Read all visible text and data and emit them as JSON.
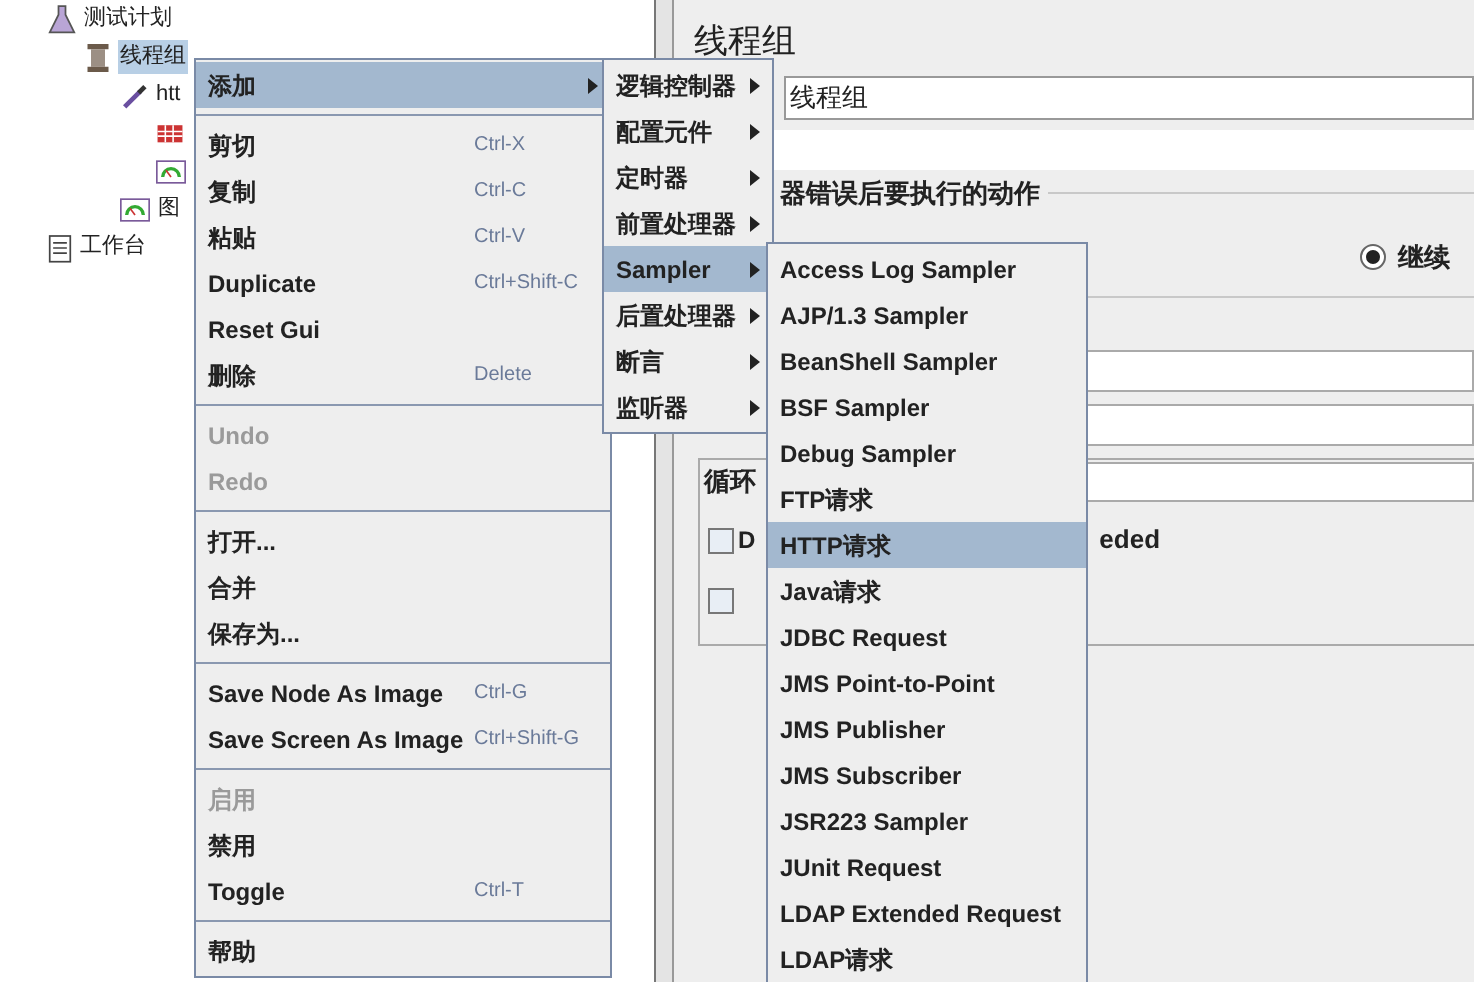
{
  "tree": [
    {
      "label": "测试计划",
      "kind": "flask",
      "selected": false,
      "children": [
        {
          "label": "线程组",
          "kind": "spool",
          "selected": true,
          "children": [
            {
              "label": "htt",
              "kind": "pipette",
              "selected": false,
              "children": [
                {
                  "kind": "table"
                },
                {
                  "kind": "gauge"
                }
              ]
            },
            {
              "label": "图",
              "kind": "gauge",
              "selected": false
            }
          ]
        }
      ]
    },
    {
      "label": "工作台",
      "kind": "notepad",
      "selected": false
    }
  ],
  "panel": {
    "title": "线程组",
    "name_value": "线程组",
    "group_title": "器错误后要执行的动作",
    "radio": {
      "label": "继续",
      "selected": true
    },
    "loop_label": "循环",
    "checkbox_1": {
      "label_start": "D",
      "label_end": "eded",
      "checked": false
    },
    "checkbox_2": {
      "checked": false
    }
  },
  "menus": [
    {
      "items": [
        {
          "kind": "item",
          "label": "添加",
          "submenu": true,
          "selected": true,
          "disabled": false
        },
        {
          "kind": "separator"
        },
        {
          "kind": "item",
          "label": "剪切",
          "shortcut": "Ctrl-X",
          "submenu": false,
          "selected": false,
          "disabled": false
        },
        {
          "kind": "item",
          "label": "复制",
          "shortcut": "Ctrl-C",
          "submenu": false,
          "selected": false,
          "disabled": false
        },
        {
          "kind": "item",
          "label": "粘贴",
          "shortcut": "Ctrl-V",
          "submenu": false,
          "selected": false,
          "disabled": false
        },
        {
          "kind": "item",
          "label": "Duplicate",
          "shortcut": "Ctrl+Shift-C",
          "submenu": false,
          "selected": false,
          "disabled": false
        },
        {
          "kind": "item",
          "label": "Reset Gui",
          "submenu": false,
          "selected": false,
          "disabled": false
        },
        {
          "kind": "item",
          "label": "删除",
          "shortcut": "Delete",
          "submenu": false,
          "selected": false,
          "disabled": false
        },
        {
          "kind": "separator"
        },
        {
          "kind": "item",
          "label": "Undo",
          "submenu": false,
          "selected": false,
          "disabled": true
        },
        {
          "kind": "item",
          "label": "Redo",
          "submenu": false,
          "selected": false,
          "disabled": true
        },
        {
          "kind": "separator"
        },
        {
          "kind": "item",
          "label": "打开...",
          "submenu": false,
          "selected": false,
          "disabled": false
        },
        {
          "kind": "item",
          "label": "合并",
          "submenu": false,
          "selected": false,
          "disabled": false
        },
        {
          "kind": "item",
          "label": "保存为...",
          "submenu": false,
          "selected": false,
          "disabled": false
        },
        {
          "kind": "separator"
        },
        {
          "kind": "item",
          "label": "Save Node As Image",
          "shortcut": "Ctrl-G",
          "submenu": false,
          "selected": false,
          "disabled": false
        },
        {
          "kind": "item",
          "label": "Save Screen As Image",
          "shortcut": "Ctrl+Shift-G",
          "submenu": false,
          "selected": false,
          "disabled": false
        },
        {
          "kind": "separator"
        },
        {
          "kind": "item",
          "label": "启用",
          "submenu": false,
          "selected": false,
          "disabled": true
        },
        {
          "kind": "item",
          "label": "禁用",
          "submenu": false,
          "selected": false,
          "disabled": false
        },
        {
          "kind": "item",
          "label": "Toggle",
          "shortcut": "Ctrl-T",
          "submenu": false,
          "selected": false,
          "disabled": false
        },
        {
          "kind": "separator"
        },
        {
          "kind": "item",
          "label": "帮助",
          "submenu": false,
          "selected": false,
          "disabled": false
        }
      ]
    },
    {
      "items": [
        {
          "kind": "item",
          "label": "逻辑控制器",
          "submenu": true,
          "selected": false,
          "disabled": false
        },
        {
          "kind": "item",
          "label": "配置元件",
          "submenu": true,
          "selected": false,
          "disabled": false
        },
        {
          "kind": "item",
          "label": "定时器",
          "submenu": true,
          "selected": false,
          "disabled": false
        },
        {
          "kind": "item",
          "label": "前置处理器",
          "submenu": true,
          "selected": false,
          "disabled": false
        },
        {
          "kind": "item",
          "label": "Sampler",
          "submenu": true,
          "selected": true,
          "disabled": false
        },
        {
          "kind": "item",
          "label": "后置处理器",
          "submenu": true,
          "selected": false,
          "disabled": false
        },
        {
          "kind": "item",
          "label": "断言",
          "submenu": true,
          "selected": false,
          "disabled": false
        },
        {
          "kind": "item",
          "label": "监听器",
          "submenu": true,
          "selected": false,
          "disabled": false
        }
      ]
    },
    {
      "items": [
        {
          "kind": "item",
          "label": "Access Log Sampler",
          "submenu": false,
          "selected": false,
          "disabled": false
        },
        {
          "kind": "item",
          "label": "AJP/1.3 Sampler",
          "submenu": false,
          "selected": false,
          "disabled": false
        },
        {
          "kind": "item",
          "label": "BeanShell Sampler",
          "submenu": false,
          "selected": false,
          "disabled": false
        },
        {
          "kind": "item",
          "label": "BSF Sampler",
          "submenu": false,
          "selected": false,
          "disabled": false
        },
        {
          "kind": "item",
          "label": "Debug Sampler",
          "submenu": false,
          "selected": false,
          "disabled": false
        },
        {
          "kind": "item",
          "label": "FTP请求",
          "submenu": false,
          "selected": false,
          "disabled": false
        },
        {
          "kind": "item",
          "label": "HTTP请求",
          "submenu": false,
          "selected": true,
          "disabled": false
        },
        {
          "kind": "item",
          "label": "Java请求",
          "submenu": false,
          "selected": false,
          "disabled": false
        },
        {
          "kind": "item",
          "label": "JDBC Request",
          "submenu": false,
          "selected": false,
          "disabled": false
        },
        {
          "kind": "item",
          "label": "JMS Point-to-Point",
          "submenu": false,
          "selected": false,
          "disabled": false
        },
        {
          "kind": "item",
          "label": "JMS Publisher",
          "submenu": false,
          "selected": false,
          "disabled": false
        },
        {
          "kind": "item",
          "label": "JMS Subscriber",
          "submenu": false,
          "selected": false,
          "disabled": false
        },
        {
          "kind": "item",
          "label": "JSR223 Sampler",
          "submenu": false,
          "selected": false,
          "disabled": false
        },
        {
          "kind": "item",
          "label": "JUnit Request",
          "submenu": false,
          "selected": false,
          "disabled": false
        },
        {
          "kind": "item",
          "label": "LDAP Extended Request",
          "submenu": false,
          "selected": false,
          "disabled": false
        },
        {
          "kind": "item",
          "label": "LDAP请求",
          "submenu": false,
          "selected": false,
          "disabled": false
        }
      ]
    }
  ]
}
